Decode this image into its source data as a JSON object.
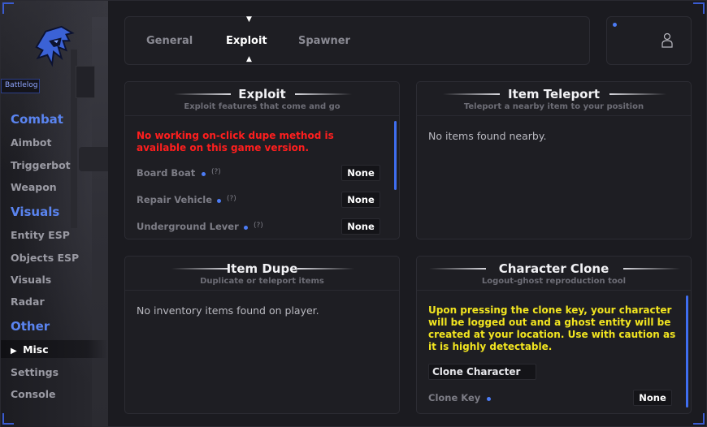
{
  "sidebar": {
    "brand_tag": "Battlelog",
    "sections": [
      {
        "label": "Combat",
        "items": [
          {
            "label": "Aimbot"
          },
          {
            "label": "Triggerbot"
          },
          {
            "label": "Weapon"
          }
        ]
      },
      {
        "label": "Visuals",
        "items": [
          {
            "label": "Entity ESP"
          },
          {
            "label": "Objects ESP"
          },
          {
            "label": "Visuals"
          },
          {
            "label": "Radar"
          }
        ]
      },
      {
        "label": "Other",
        "items": [
          {
            "label": "Misc",
            "active_marker": "▶"
          },
          {
            "label": "Settings"
          },
          {
            "label": "Console"
          }
        ]
      }
    ]
  },
  "tabs": [
    {
      "label": "General"
    },
    {
      "label": "Exploit"
    },
    {
      "label": "Spawner"
    }
  ],
  "tab_arrows": {
    "up": "▼",
    "down": "▲"
  },
  "panels": {
    "exploit": {
      "title": "Exploit",
      "subtitle": "Exploit features that come and go",
      "warning": "No working on-click dupe method is available on this game version.",
      "options": [
        {
          "label": "Board Boat",
          "help": "(?)",
          "key": "None"
        },
        {
          "label": "Repair Vehicle",
          "help": "(?)",
          "key": "None"
        },
        {
          "label": "Underground Lever",
          "help": "(?)",
          "key": "None"
        }
      ]
    },
    "item_teleport": {
      "title": "Item Teleport",
      "subtitle": "Teleport a nearby item to your position",
      "message": "No items found nearby."
    },
    "item_dupe": {
      "title": "Item Dupe",
      "subtitle": "Duplicate or teleport items",
      "message": "No inventory items found on player."
    },
    "character_clone": {
      "title": "Character Clone",
      "subtitle": "Logout-ghost reproduction tool",
      "warning": "Upon pressing the clone key, your character will be logged out and a ghost entity will be created at your location. Use with caution as it is highly detectable.",
      "button": "Clone Character",
      "key_label": "Clone Key",
      "key_value": "None"
    }
  },
  "colors": {
    "accent": "#4c7cf5",
    "section": "#5a84f0",
    "warn_red": "#ff1e1e",
    "warn_yellow": "#f2e520",
    "background": "#1b1b20",
    "panel": "#1e1e23"
  }
}
